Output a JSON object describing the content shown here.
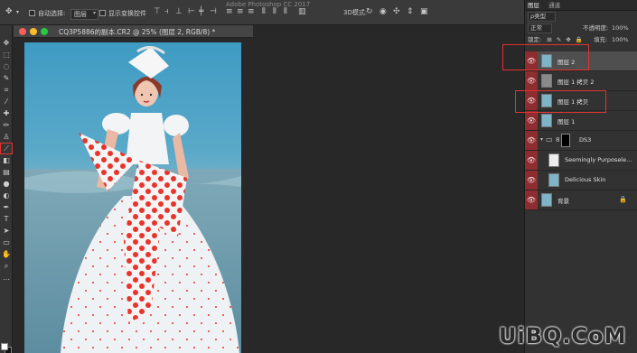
{
  "app": {
    "title": "Adobe Photoshop CC 2017"
  },
  "options_bar": {
    "auto_select_label": "自动选择:",
    "auto_select_value": "图层",
    "transform_controls_label": "显示变换控件"
  },
  "document": {
    "tab_title": "CQ3P5886的副本.CR2 @ 25% (图层 2, RGB/8) *"
  },
  "colors": {
    "accent_red": "#e0332f",
    "eye_column": "#8e2d2f",
    "panel_bg": "#323232"
  },
  "panels": {
    "tabs": [
      "图层",
      "通道"
    ],
    "filter_label": "ρ类型",
    "blend_mode": "正常",
    "opacity_label": "不透明度:",
    "opacity_value": "100%",
    "lock_label": "锁定:",
    "fill_label": "填充:",
    "fill_value": "100%",
    "layers": [
      {
        "name": "图层 2",
        "thumb": "photo",
        "selected": true
      },
      {
        "name": "图层 1 拷贝 2",
        "thumb": "gray",
        "selected": false
      },
      {
        "name": "图层 1 拷贝",
        "thumb": "photo",
        "selected": false
      },
      {
        "name": "图层 1",
        "thumb": "photo",
        "selected": false
      },
      {
        "name": "DS3",
        "thumb": "folder",
        "selected": false
      },
      {
        "name": "Seemingly Purposele...",
        "thumb": "white",
        "selected": false
      },
      {
        "name": "Delicious Skin",
        "thumb": "photo",
        "selected": false
      },
      {
        "name": "背景",
        "thumb": "photo",
        "selected": false,
        "locked": true
      }
    ]
  },
  "watermark": "UiBQ.CoM"
}
